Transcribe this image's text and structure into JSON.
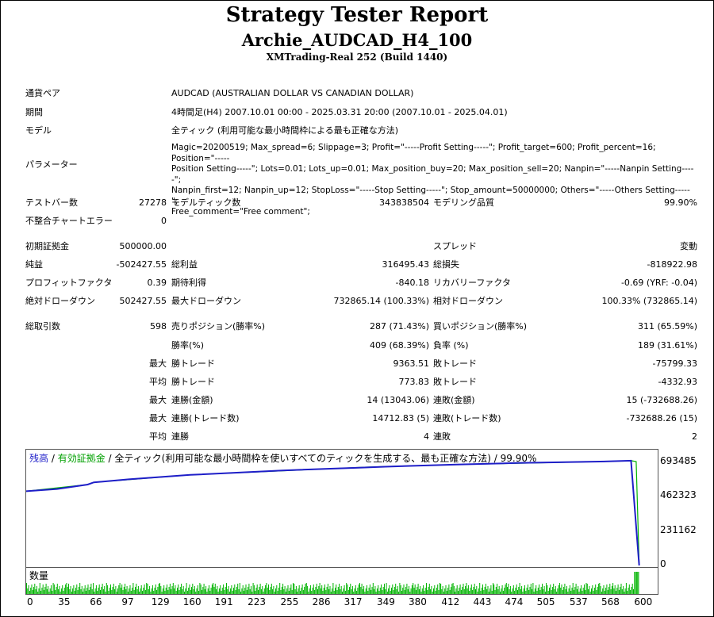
{
  "report": {
    "title": "Strategy Tester Report",
    "ea_name": "Archie_AUDCAD_H4_100",
    "server": "XMTrading-Real 252 (Build 1440)"
  },
  "info": [
    {
      "label": "通貨ペア",
      "value": "AUDCAD (AUSTRALIAN DOLLAR VS CANADIAN DOLLAR)"
    },
    {
      "label": "期間",
      "value": "4時間足(H4) 2007.10.01 00:00 - 2025.03.31 20:00 (2007.10.01 - 2025.04.01)"
    },
    {
      "label": "モデル",
      "value": "全ティック (利用可能な最小時間枠による最も正確な方法)"
    }
  ],
  "params": {
    "label": "パラメーター",
    "lines": [
      "Magic=20200519; Max_spread=6; Slippage=3; Profit=\"-----Profit Setting-----\"; Profit_target=600; Profit_percent=16; Position=\"-----",
      "Position Setting-----\"; Lots=0.01; Lots_up=0.01; Max_position_buy=20; Max_position_sell=20; Nanpin=\"-----Nanpin Setting-----\";",
      "Nanpin_first=12; Nanpin_up=12; StopLoss=\"-----Stop Setting-----\"; Stop_amount=50000000; Others=\"-----Others Setting-----\";",
      "Free_comment=\"Free comment\";"
    ]
  },
  "stats": {
    "bars_label": "テストバー数",
    "bars": "27278",
    "ticks_label": "モデルティック数",
    "ticks": "343838504",
    "quality_label": "モデリング品質",
    "quality": "99.90%",
    "mismatch_label": "不整合チャートエラー",
    "mismatch": "0",
    "deposit_label": "初期証拠金",
    "deposit": "500000.00",
    "spread_label": "スプレッド",
    "spread": "変動",
    "net_label": "純益",
    "net": "-502427.55",
    "gross_profit_label": "総利益",
    "gross_profit": "316495.43",
    "gross_loss_label": "総損失",
    "gross_loss": "-818922.98",
    "pf_label": "プロフィットファクタ",
    "pf": "0.39",
    "expected_label": "期待利得",
    "expected": "-840.18",
    "recovery_label": "リカバリーファクタ",
    "recovery": "-0.69 (YRF: -0.04)",
    "abs_dd_label": "絶対ドローダウン",
    "abs_dd": "502427.55",
    "max_dd_label": "最大ドローダウン",
    "max_dd": "732865.14 (100.33%)",
    "rel_dd_label": "相対ドローダウン",
    "rel_dd": "100.33% (732865.14)",
    "trades_label": "総取引数",
    "trades": "598",
    "short_label": "売りポジション(勝率%)",
    "short": "287 (71.43%)",
    "long_label": "買いポジション(勝率%)",
    "long": "311 (65.59%)",
    "win_label": "勝率(%)",
    "win": "409 (68.39%)",
    "loss_label": "負率 (%)",
    "loss": "189 (31.61%)",
    "max_word": "最大",
    "avg_word": "平均",
    "largest_win_label": "勝トレード",
    "largest_win": "9363.51",
    "largest_loss_label": "敗トレード",
    "largest_loss": "-75799.33",
    "avg_win_label": "勝トレード",
    "avg_win": "773.83",
    "avg_loss_label": "敗トレード",
    "avg_loss": "-4332.93",
    "max_cons_win_label": "連勝(金額)",
    "max_cons_win": "14 (13043.06)",
    "max_cons_loss_label": "連敗(金額)",
    "max_cons_loss": "15 (-732688.26)",
    "max_cons_profit_label": "連勝(トレード数)",
    "max_cons_profit": "14712.83 (5)",
    "max_cons_lossamt_label": "連敗(トレード数)",
    "max_cons_lossamt": "-732688.26 (15)",
    "avg_cons_win_label": "連勝",
    "avg_cons_win": "4",
    "avg_cons_loss_label": "連敗",
    "avg_cons_loss": "2"
  },
  "chart_legend": {
    "balance": "残高",
    "sep1": " / ",
    "equity": "有効証拠金",
    "sep2": " / ",
    "rest": "全ティック(利用可能な最小時間枠を使いすべてのティックを生成する、最も正確な方法) / 99.90%"
  },
  "volume_label": "数量",
  "colors": {
    "balance": "#1e1ec8",
    "equity": "#00b400",
    "volume": "#00b400"
  },
  "chart_data": {
    "type": "line",
    "y_ticks": [
      693485,
      462323,
      231162,
      0
    ],
    "x_ticks": [
      0,
      35,
      66,
      97,
      129,
      160,
      191,
      223,
      255,
      286,
      317,
      349,
      380,
      412,
      443,
      474,
      505,
      537,
      568,
      600
    ],
    "y_tick_labels": [
      "693485",
      "462323",
      "231162",
      "0"
    ],
    "x_tick_labels": [
      "0",
      "35",
      "66",
      "97",
      "129",
      "160",
      "191",
      "223",
      "255",
      "286",
      "317",
      "349",
      "380",
      "412",
      "443",
      "474",
      "505",
      "537",
      "568",
      "600"
    ],
    "xlim": [
      0,
      616
    ],
    "ylim": [
      0,
      780000
    ],
    "series": [
      {
        "name": "残高",
        "x": [
          0,
          30,
          60,
          66,
          100,
          160,
          250,
          330,
          350,
          420,
          480,
          560,
          590,
          598
        ],
        "values": [
          500000,
          515000,
          545000,
          560000,
          580000,
          610000,
          640000,
          660000,
          665000,
          680000,
          690000,
          700000,
          706000,
          0
        ]
      },
      {
        "name": "有効証拠金",
        "x": [
          0,
          60,
          66,
          160,
          330,
          420,
          560,
          590,
          595,
          598
        ],
        "values": [
          500000,
          545000,
          560000,
          610000,
          662000,
          680000,
          700000,
          706000,
          700000,
          0
        ]
      }
    ]
  }
}
